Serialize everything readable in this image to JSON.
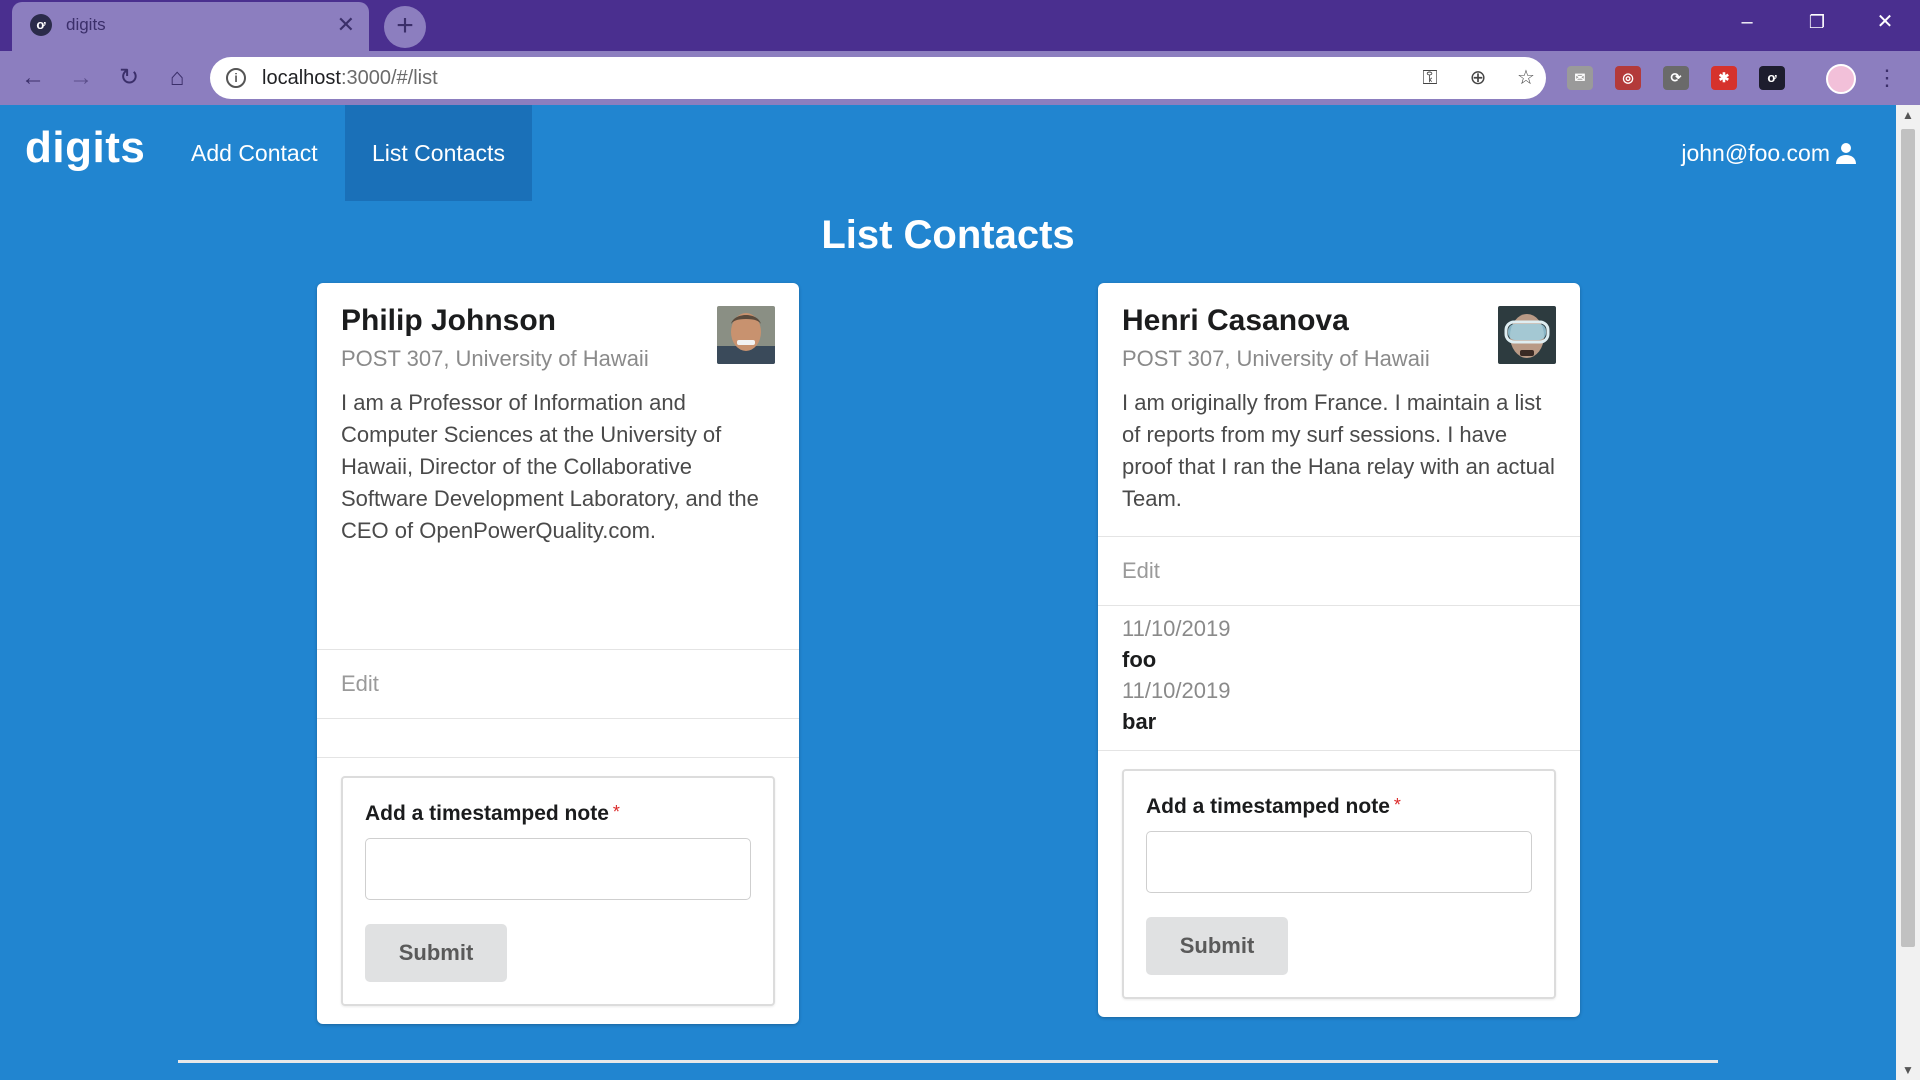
{
  "browser": {
    "tab_title": "digits",
    "tab_close": "✕",
    "new_tab": "+",
    "url_host": "localhost",
    "url_path": ":3000/#/list",
    "window_controls": {
      "minimize": "–",
      "restore": "❐",
      "close": "✕"
    }
  },
  "navbar": {
    "brand": "digits",
    "items": [
      {
        "label": "Add Contact",
        "active": false
      },
      {
        "label": "List Contacts",
        "active": true
      }
    ],
    "user": "john@foo.com"
  },
  "page": {
    "title": "List Contacts"
  },
  "contacts": [
    {
      "name": "Philip Johnson",
      "address": "POST 307, University of Hawaii",
      "description": "I am a Professor of Information and Computer Sciences at the University of Hawaii, Director of the Collaborative Software Development Laboratory, and the CEO of OpenPowerQuality.com.",
      "edit_label": "Edit",
      "notes": [],
      "form": {
        "label": "Add a timestamped note",
        "required_mark": "*",
        "submit": "Submit",
        "input_value": ""
      }
    },
    {
      "name": "Henri Casanova",
      "address": "POST 307, University of Hawaii",
      "description": "I am originally from France. I maintain a list of reports from my surf sessions. I have proof that I ran the Hana relay with an actual Team.",
      "edit_label": "Edit",
      "notes": [
        {
          "date": "11/10/2019",
          "text": "foo"
        },
        {
          "date": "11/10/2019",
          "text": "bar"
        }
      ],
      "form": {
        "label": "Add a timestamped note",
        "required_mark": "*",
        "submit": "Submit",
        "input_value": ""
      }
    }
  ],
  "colors": {
    "page_bg": "#2185d0",
    "active_menu": "#1a70b8",
    "browser_frame": "#4a2f8f",
    "browser_toolbar": "#8c7ebf",
    "required": "#db2828"
  }
}
